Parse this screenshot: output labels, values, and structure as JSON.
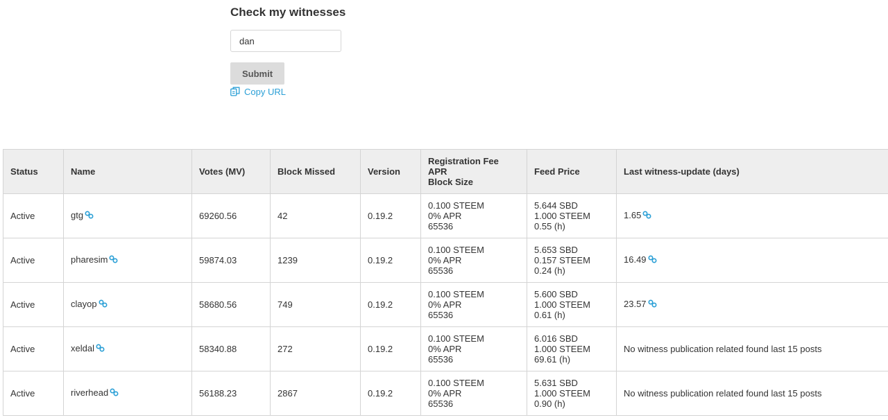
{
  "form": {
    "title": "Check my witnesses",
    "username_value": "dan",
    "submit_label": "Submit",
    "copy_url_label": "Copy URL"
  },
  "table": {
    "headers": {
      "status": "Status",
      "name": "Name",
      "votes": "Votes (MV)",
      "block_missed": "Block Missed",
      "version": "Version",
      "fee_line1": "Registration Fee",
      "fee_line2": "APR",
      "fee_line3": "Block Size",
      "feed_price": "Feed Price",
      "last_update": "Last witness-update (days)"
    },
    "rows": [
      {
        "status": "Active",
        "name": "gtg",
        "votes": "69260.56",
        "block_missed": "42",
        "version": "0.19.2",
        "fee": "0.100 STEEM",
        "apr": "0% APR",
        "block_size": "65536",
        "feed_sbd": "5.644 SBD",
        "feed_steem": "1.000 STEEM",
        "feed_age": "0.55 (h)",
        "last_update": "1.65",
        "last_update_link": true
      },
      {
        "status": "Active",
        "name": "pharesim",
        "votes": "59874.03",
        "block_missed": "1239",
        "version": "0.19.2",
        "fee": "0.100 STEEM",
        "apr": "0% APR",
        "block_size": "65536",
        "feed_sbd": "5.653 SBD",
        "feed_steem": "0.157 STEEM",
        "feed_age": "0.24 (h)",
        "last_update": "16.49",
        "last_update_link": true
      },
      {
        "status": "Active",
        "name": "clayop",
        "votes": "58680.56",
        "block_missed": "749",
        "version": "0.19.2",
        "fee": "0.100 STEEM",
        "apr": "0% APR",
        "block_size": "65536",
        "feed_sbd": "5.600 SBD",
        "feed_steem": "1.000 STEEM",
        "feed_age": "0.61 (h)",
        "last_update": "23.57",
        "last_update_link": true
      },
      {
        "status": "Active",
        "name": "xeldal",
        "votes": "58340.88",
        "block_missed": "272",
        "version": "0.19.2",
        "fee": "0.100 STEEM",
        "apr": "0% APR",
        "block_size": "65536",
        "feed_sbd": "6.016 SBD",
        "feed_steem": "1.000 STEEM",
        "feed_age": "69.61 (h)",
        "last_update": "No witness publication related found last 15 posts",
        "last_update_link": false
      },
      {
        "status": "Active",
        "name": "riverhead",
        "votes": "56188.23",
        "block_missed": "2867",
        "version": "0.19.2",
        "fee": "0.100 STEEM",
        "apr": "0% APR",
        "block_size": "65536",
        "feed_sbd": "5.631 SBD",
        "feed_steem": "1.000 STEEM",
        "feed_age": "0.90 (h)",
        "last_update": "No witness publication related found last 15 posts",
        "last_update_link": false
      }
    ]
  },
  "colors": {
    "link": "#2a9fd6",
    "header_bg": "#eeeeee",
    "button_bg": "#dcdcdc",
    "border": "#d4d4d4"
  },
  "icons": {
    "link": "link-icon",
    "copy": "copy-icon"
  }
}
